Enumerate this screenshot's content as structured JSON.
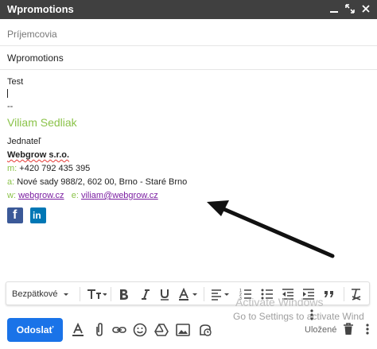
{
  "window": {
    "title": "Wpromotions",
    "controls": [
      "minimize-icon",
      "expand-icon",
      "close-icon"
    ]
  },
  "fields": {
    "recipients_placeholder": "Príjemcovia",
    "subject": "Wpromotions"
  },
  "body": {
    "text": "Test",
    "sig_sep": "--",
    "name": "Viliam Sedliak",
    "position": "Jednateľ",
    "company": "Webgrow s.r.o.",
    "phone_label": "m:",
    "phone": "+420 792 435 395",
    "address_label": "a:",
    "address": "Nové sady 988/2, 602 00, Brno - Staré Brno",
    "web_label": "w:",
    "web": "webgrow.cz",
    "email_label": "e:",
    "email": "viliam@webgrow.cz"
  },
  "toolbar": {
    "font": "Bezpätkové",
    "font_color": "#444444"
  },
  "watermark": {
    "line1": "Activate Windows",
    "line2": "Go to Settings to activate Wind"
  },
  "footer": {
    "send": "Odoslať",
    "saved": "Uložené"
  },
  "colors": {
    "titlebar": "#404040",
    "send": "#1a73e8",
    "signature_green": "#8bc34a",
    "link": "#7b1fa2"
  }
}
